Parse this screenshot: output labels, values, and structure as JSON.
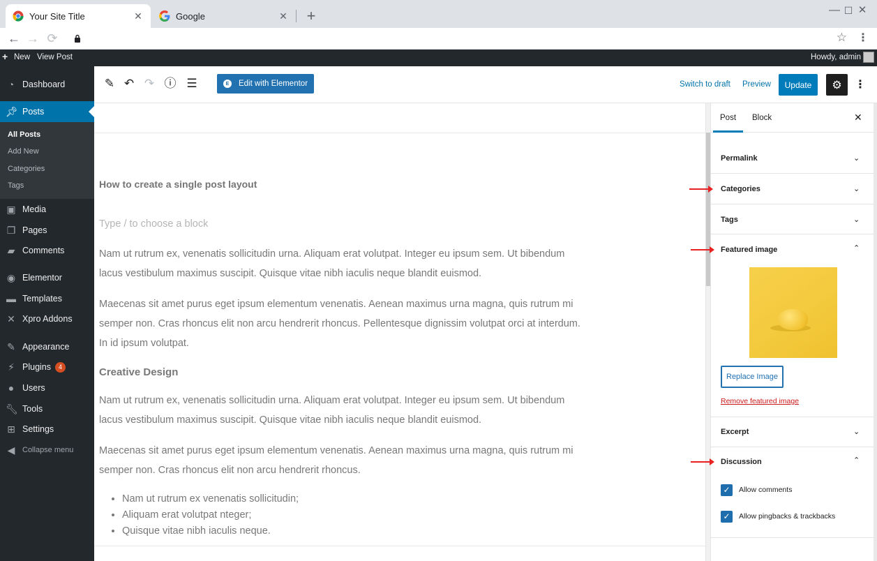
{
  "browser": {
    "tabs": [
      {
        "title": "Your Site Title",
        "active": true
      },
      {
        "title": "Google",
        "active": false
      }
    ],
    "close_glyph": "✕",
    "new_tab_glyph": "+",
    "window_controls": [
      "—",
      "☐",
      "✕"
    ]
  },
  "adminbar": {
    "new_label": "New",
    "view_post_label": "View Post",
    "greeting": "Howdy, admin"
  },
  "sidebar": {
    "items": [
      {
        "label": "Dashboard",
        "icon": "dashboard-icon"
      },
      {
        "label": "Posts",
        "icon": "pin-icon",
        "current": true
      },
      {
        "label": "Media",
        "icon": "media-icon"
      },
      {
        "label": "Pages",
        "icon": "pages-icon"
      },
      {
        "label": "Comments",
        "icon": "comments-icon"
      },
      {
        "label": "Elementor",
        "icon": "elementor-icon"
      },
      {
        "label": "Templates",
        "icon": "folder-icon"
      },
      {
        "label": "Xpro Addons",
        "icon": "xpro-icon"
      },
      {
        "label": "Appearance",
        "icon": "brush-icon"
      },
      {
        "label": "Plugins",
        "icon": "plugin-icon",
        "badge": "4"
      },
      {
        "label": "Users",
        "icon": "users-icon"
      },
      {
        "label": "Tools",
        "icon": "wrench-icon"
      },
      {
        "label": "Settings",
        "icon": "settings-icon"
      }
    ],
    "submenu": [
      "All Posts",
      "Add New",
      "Categories",
      "Tags"
    ],
    "collapse_label": "Collapse menu"
  },
  "toolbar": {
    "elementor_label": "Edit with Elementor",
    "switch_to_draft": "Switch to draft",
    "preview": "Preview",
    "update": "Update"
  },
  "post": {
    "title": "How to create a single post layout",
    "placeholder": "Type / to choose a block",
    "para1": "Nam ut rutrum ex, venenatis sollicitudin urna. Aliquam erat volutpat. Integer eu ipsum sem. Ut bibendum lacus vestibulum maximus suscipit. Quisque vitae nibh iaculis neque blandit euismod.",
    "para2": "Maecenas sit amet purus eget ipsum elementum venenatis. Aenean maximus urna magna, quis rutrum mi semper non. Cras rhoncus elit non arcu hendrerit rhoncus. Pellentesque dignissim volutpat orci at interdum. In id ipsum volutpat.",
    "heading2": "Creative Design",
    "para3": "Nam ut rutrum ex, venenatis sollicitudin urna. Aliquam erat volutpat. Integer eu ipsum sem. Ut bibendum lacus vestibulum maximus suscipit. Quisque vitae nibh iaculis neque blandit euismod.",
    "para4": "Maecenas sit amet purus eget ipsum elementum venenatis. Aenean maximus urna magna, quis rutrum mi semper non. Cras rhoncus elit non arcu hendrerit rhoncus.",
    "list": [
      "Nam ut rutrum ex venenatis sollicitudin;",
      "Aliquam erat volutpat nteger;",
      "Quisque vitae nibh iaculis neque."
    ]
  },
  "panel": {
    "tab_post": "Post",
    "tab_block": "Block",
    "sections": {
      "permalink": "Permalink",
      "categories": "Categories",
      "tags": "Tags",
      "featured_image": "Featured image",
      "excerpt": "Excerpt",
      "discussion": "Discussion"
    },
    "replace_image": "Replace Image",
    "remove_featured_image": "Remove featured image",
    "allow_comments": "Allow comments",
    "allow_pingbacks": "Allow pingbacks & trackbacks"
  },
  "colors": {
    "wp_blue": "#007cba",
    "admin_dark": "#23282d",
    "annotation_red": "#e82222"
  }
}
